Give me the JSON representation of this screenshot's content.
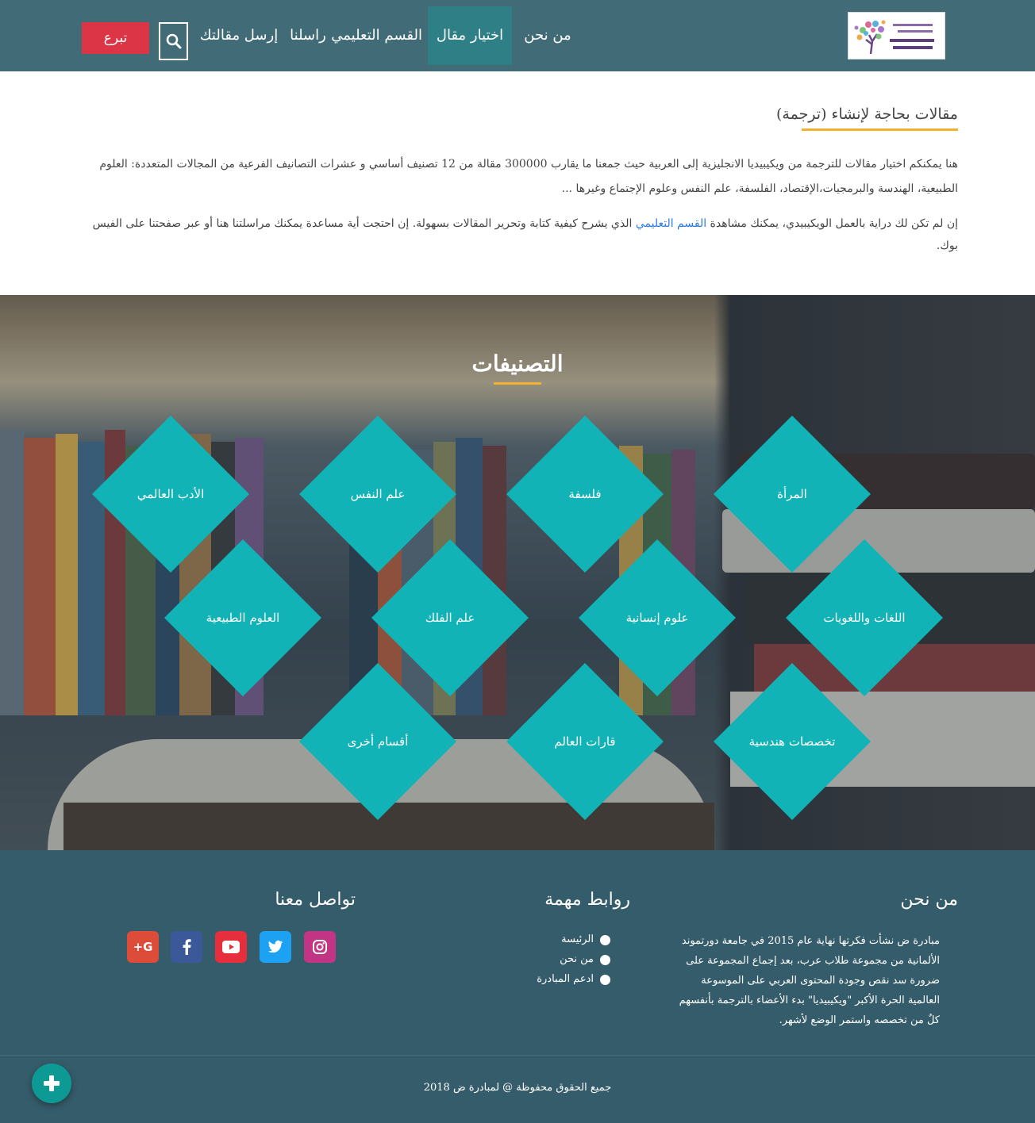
{
  "header": {
    "logo_alt": "مبادرة ض لتطوير الويكيبيديا العربية",
    "nav": [
      {
        "label": "من نحن"
      },
      {
        "label": "اختيار مقال"
      },
      {
        "label": "القسم التعليمي"
      },
      {
        "label": "راسلنا"
      },
      {
        "label": "إرسل مقالتك"
      }
    ],
    "active_nav": "اختيار مقال",
    "search_icon": "search-icon",
    "donate_label": "تبرع"
  },
  "intro": {
    "title": "مقالات بحاجة لإنشاء (ترجمة)",
    "paragraph1": "هنا يمكنكم اختيار مقالات للترجمة من ويكيبيديا الانجليزية إلى العربية حيث جمعنا ما يقارب 300000 مقالة من 12 تصنيف أساسي و عشرات التصانيف الفرعية من المجالات المتعددة: العلوم الطبيعية، الهندسة والبرمجيات،الإقتصاد، الفلسفة، علم النفس وعلوم الإجتماع وغيرها ...",
    "paragraph2_before": "إن لم تكن لك دراية بالعمل الويكيبيدي، يمكنك مشاهدة ",
    "paragraph2_link": "القسم التعليمي",
    "paragraph2_after": " الذي يشرح كيفية كتابة وتحرير المقالات بسهولة. إن احتجت أية مساعدة يمكنك مراسلتنا هنا أو عبر صفحتنا على الفيس بوك."
  },
  "categories": {
    "title": "التصنيفات",
    "items": [
      {
        "label": "المرأة"
      },
      {
        "label": "فلسفة"
      },
      {
        "label": "علم النفس"
      },
      {
        "label": "الأدب العالمي"
      },
      {
        "label": "اللغات واللغويات"
      },
      {
        "label": "علوم إنسانية"
      },
      {
        "label": "علم الفلك"
      },
      {
        "label": "العلوم الطبيعية"
      },
      {
        "label": "تخصصات هندسية"
      },
      {
        "label": "قارات العالم"
      },
      {
        "label": "أقسام أخرى"
      }
    ],
    "tile_color": "#11b3b6"
  },
  "footer": {
    "about_title": "من نحن",
    "about_text": "مبادرة ض نشأت فكرتها نهاية عام 2015 في جامعة دورتموند الألمانية من مجموعة طلاب عرب، بعد إجماع المجموعة على ضرورة سد نقص وجودة المحتوى العربي على الموسوعة العالمية الحرة الأكبر \"ويكيبيديا\" بدء الأعضاء بالترجمة بأنفسهم كلٌ من تخصصه واستمر الوضع لأشهر.",
    "links_title": "روابط مهمة",
    "links": [
      {
        "label": "الرئيسة"
      },
      {
        "label": "من نحن"
      },
      {
        "label": "ادعم المبادرة"
      }
    ],
    "contact_title": "تواصل معنا",
    "social": [
      {
        "icon": "instagram-icon",
        "color": "#c13584"
      },
      {
        "icon": "twitter-icon",
        "color": "#1da1f2"
      },
      {
        "icon": "youtube-icon",
        "color": "#e62e3c"
      },
      {
        "icon": "facebook-icon",
        "color": "#3b5998"
      },
      {
        "icon": "google-plus-icon",
        "color": "#dd4b39",
        "text": "G+"
      }
    ],
    "copyright": "جميع الحقوق محفوظة @ لمبادرة ض 2018"
  }
}
